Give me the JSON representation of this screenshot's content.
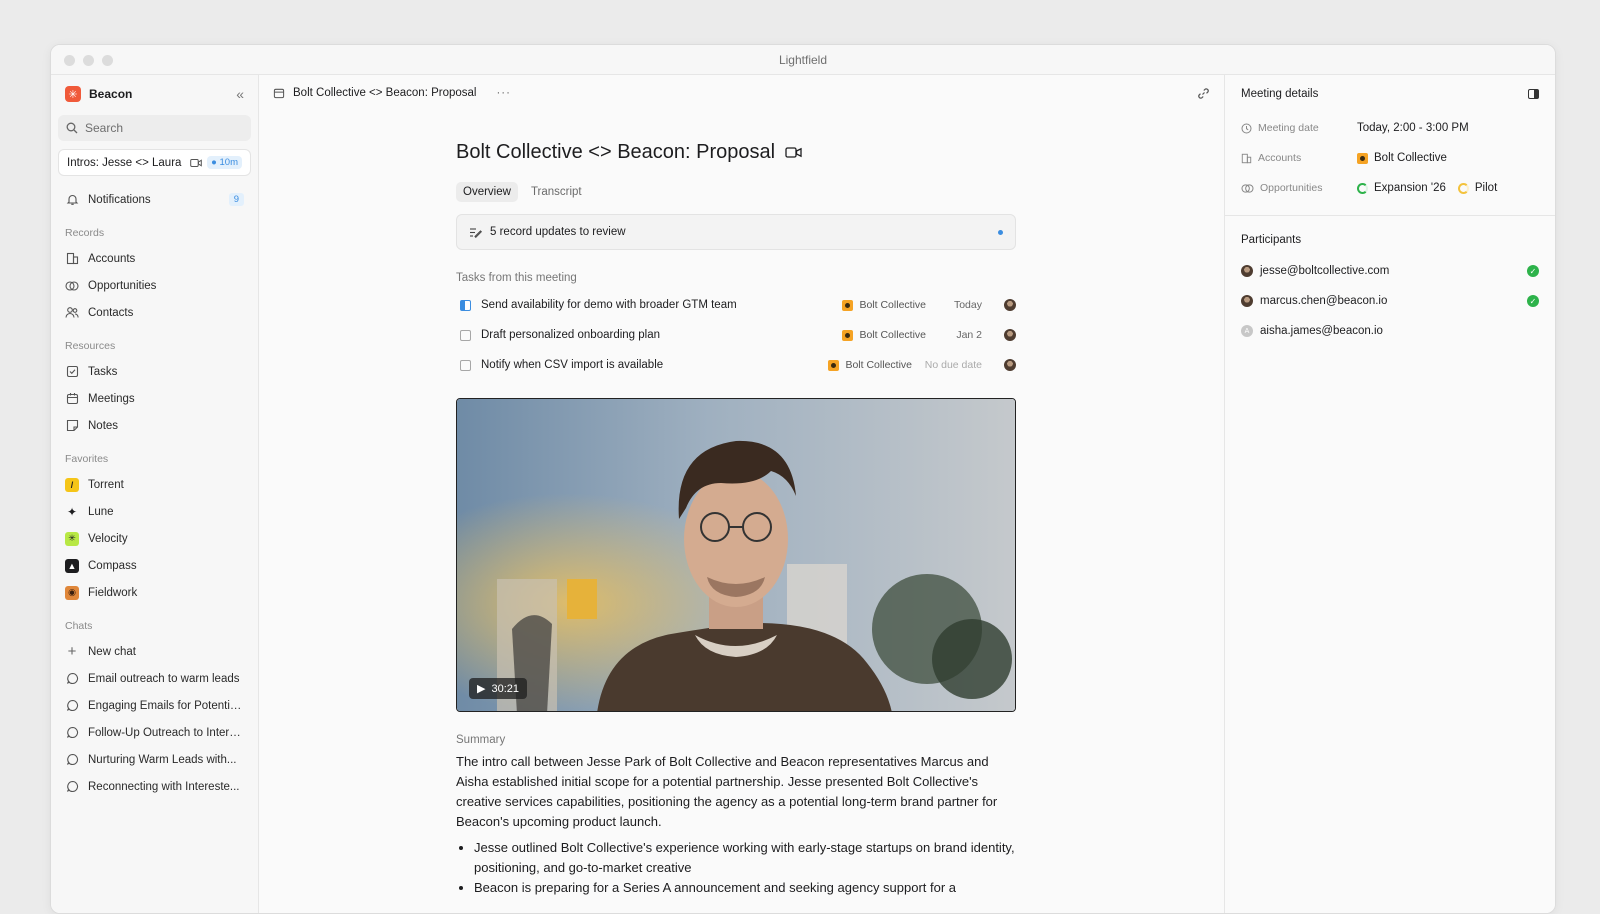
{
  "window": {
    "title": "Lightfield"
  },
  "sidebar": {
    "workspace": "Beacon",
    "search_placeholder": "Search",
    "meeting_card": {
      "label": "Intros: Jesse <> Laura",
      "badge": "10m"
    },
    "notifications": {
      "label": "Notifications",
      "count": "9"
    },
    "records_label": "Records",
    "records": [
      {
        "label": "Accounts",
        "icon": "building-icon"
      },
      {
        "label": "Opportunities",
        "icon": "opportunity-icon"
      },
      {
        "label": "Contacts",
        "icon": "contacts-icon"
      }
    ],
    "resources_label": "Resources",
    "resources": [
      {
        "label": "Tasks",
        "icon": "checkbox-icon"
      },
      {
        "label": "Meetings",
        "icon": "calendar-icon"
      },
      {
        "label": "Notes",
        "icon": "note-icon"
      }
    ],
    "favorites_label": "Favorites",
    "favorites": [
      {
        "label": "Torrent",
        "color": "#f5c518"
      },
      {
        "label": "Lune",
        "color": "#2a2a2a"
      },
      {
        "label": "Velocity",
        "color": "#b8e845"
      },
      {
        "label": "Compass",
        "color": "#1d1d1f"
      },
      {
        "label": "Fieldwork",
        "color": "#e0873a"
      }
    ],
    "chats_label": "Chats",
    "new_chat": "New chat",
    "chats": [
      "Email outreach to warm leads",
      "Engaging Emails for Potential...",
      "Follow-Up Outreach to Intere...",
      "Nurturing Warm Leads with...",
      "Reconnecting with Intereste..."
    ]
  },
  "main": {
    "breadcrumb": "Bolt Collective <> Beacon: Proposal",
    "title": "Bolt Collective <> Beacon: Proposal",
    "tabs": [
      "Overview",
      "Transcript"
    ],
    "review": "5 record updates to review",
    "tasks_label": "Tasks from this meeting",
    "tasks": [
      {
        "title": "Send availability for demo with broader GTM team",
        "account": "Bolt Collective",
        "due": "Today"
      },
      {
        "title": "Draft personalized onboarding plan",
        "account": "Bolt Collective",
        "due": "Jan 2"
      },
      {
        "title": "Notify when CSV import is available",
        "account": "Bolt Collective",
        "due": "No due date"
      }
    ],
    "video_duration": "30:21",
    "summary_label": "Summary",
    "summary": "The intro call between Jesse Park of Bolt Collective and Beacon representatives Marcus and Aisha established initial scope for a potential partnership. Jesse presented Bolt Collective's creative services capabilities, positioning the agency as a potential long-term brand partner for Beacon's upcoming product launch.",
    "bullets": [
      "Jesse outlined Bolt Collective's experience working with early-stage startups on brand identity, positioning, and go-to-market creative",
      "Beacon is preparing for a Series A announcement and seeking agency support for a"
    ]
  },
  "details": {
    "title": "Meeting details",
    "meeting_date_label": "Meeting date",
    "meeting_date": "Today, 2:00 - 3:00 PM",
    "accounts_label": "Accounts",
    "account": "Bolt Collective",
    "opportunities_label": "Opportunities",
    "opportunities": [
      "Expansion '26",
      "Pilot"
    ],
    "participants_label": "Participants",
    "participants": [
      {
        "email": "jesse@boltcollective.com",
        "confirmed": true
      },
      {
        "email": "marcus.chen@beacon.io",
        "confirmed": true
      },
      {
        "email": "aisha.james@beacon.io",
        "confirmed": false,
        "initial": "A"
      }
    ]
  }
}
